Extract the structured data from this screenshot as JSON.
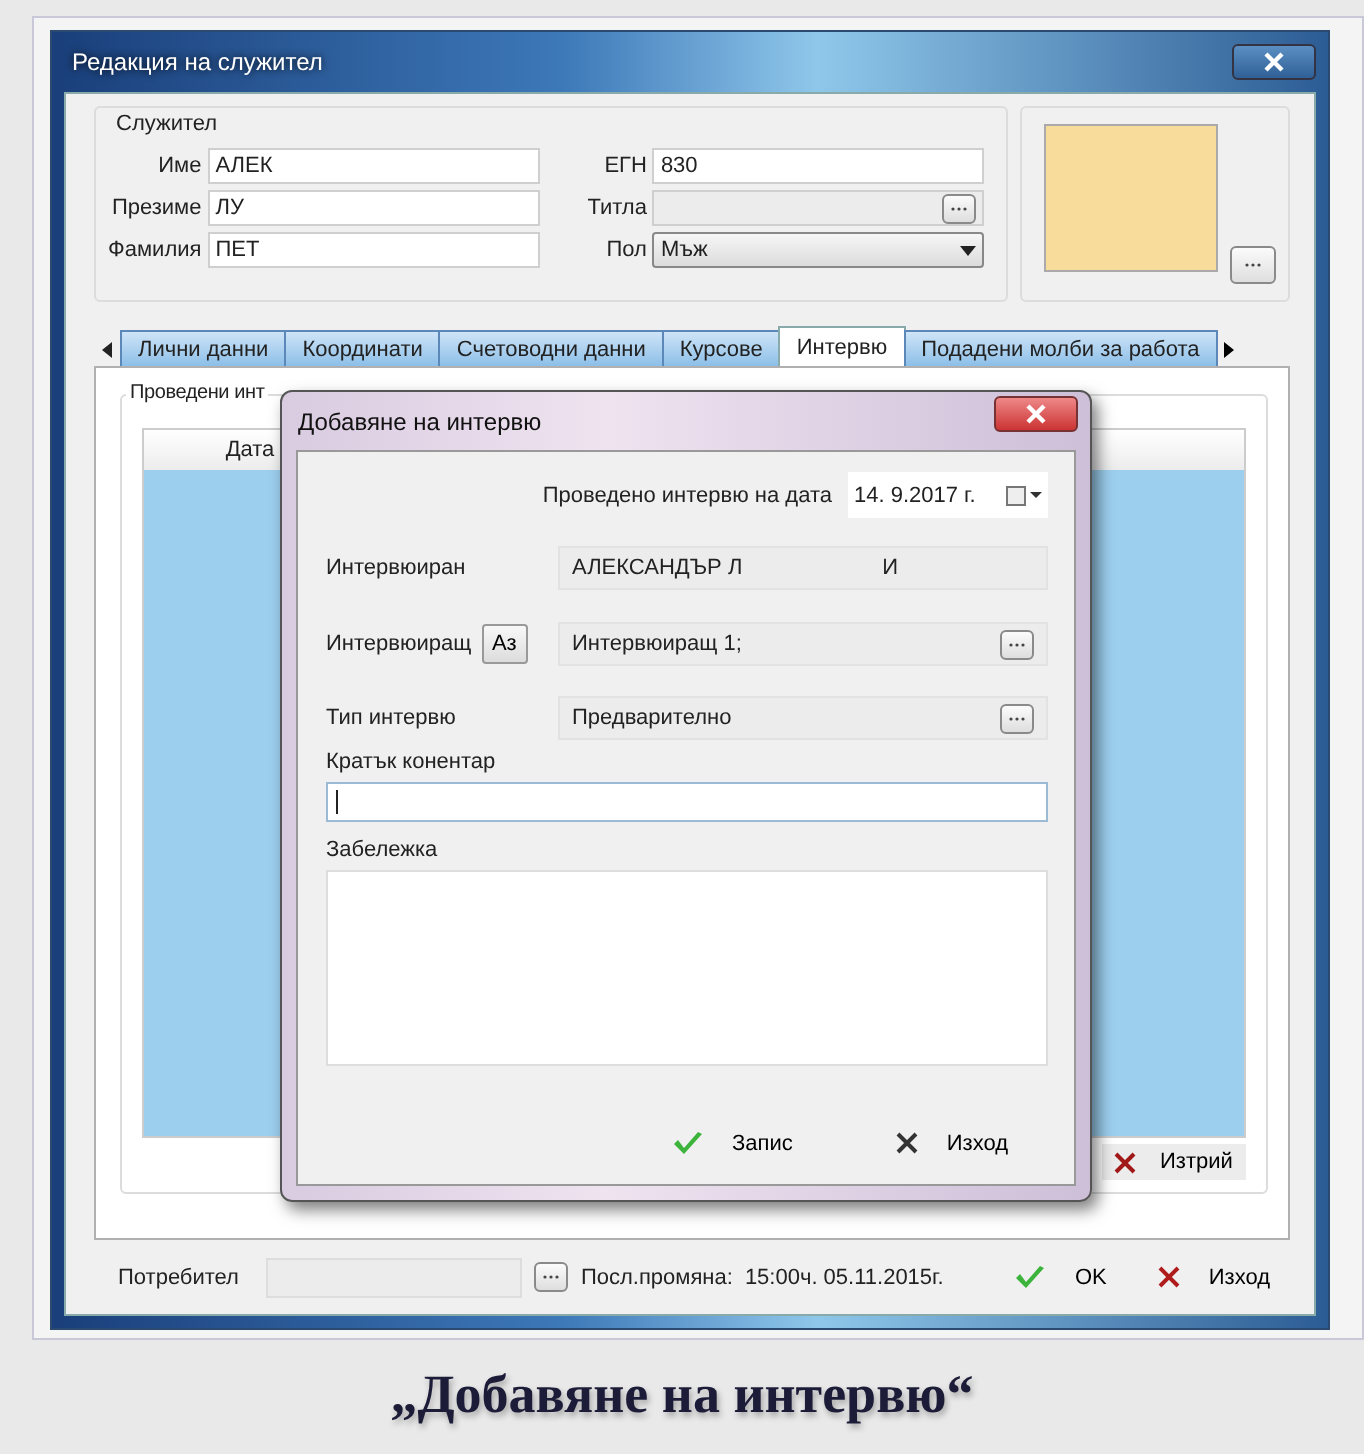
{
  "window": {
    "title": "Редакция на служител"
  },
  "employee": {
    "group_title": "Служител",
    "fields": [
      {
        "label": "Име",
        "value": "АЛЕК"
      },
      {
        "label": "Презиме",
        "value": "ЛУ"
      },
      {
        "label": "Фамилия",
        "value": "ПЕТ"
      }
    ],
    "egn": {
      "label": "ЕГН",
      "value": "830"
    },
    "title_field": {
      "label": "Титла"
    },
    "gender": {
      "label": "Пол",
      "value": "Мъж"
    }
  },
  "tabs": [
    {
      "label": "Лични данни",
      "selected": false
    },
    {
      "label": "Координати",
      "selected": false
    },
    {
      "label": "Счетоводни данни",
      "selected": false
    },
    {
      "label": "Курсове",
      "selected": false
    },
    {
      "label": "Интервю",
      "selected": true
    },
    {
      "label": "Подадени молби за работа",
      "selected": false
    }
  ],
  "interviews_group": {
    "title": "Проведени инт",
    "columns": [
      "Дата"
    ],
    "delete_button": "Изтрий"
  },
  "footer": {
    "user_label": "Потребител",
    "last_change_label": "Посл.промяна:",
    "last_change_value": "15:00ч. 05.11.2015г.",
    "ok_button": "OK",
    "exit_button": "Изход"
  },
  "dialog": {
    "title": "Добавяне на интервю",
    "date_label": "Проведено интервю на дата",
    "date_value": "14. 9.2017 г.",
    "interviewee_label": "Интервюиран",
    "interviewee_value": "АЛЕКСАНДЪР Л",
    "interviewee_value_end": "И",
    "interviewer_label": "Интервюиращ",
    "me_button": "Аз",
    "interviewer_value": "Интервюиращ 1;",
    "type_label": "Тип интервю",
    "type_value": "Предварително",
    "comment_label": "Кратък конентар",
    "note_label": "Забележка",
    "save_button": "Запис",
    "exit_button": "Изход"
  },
  "caption": "„Добавяне на интервю“"
}
